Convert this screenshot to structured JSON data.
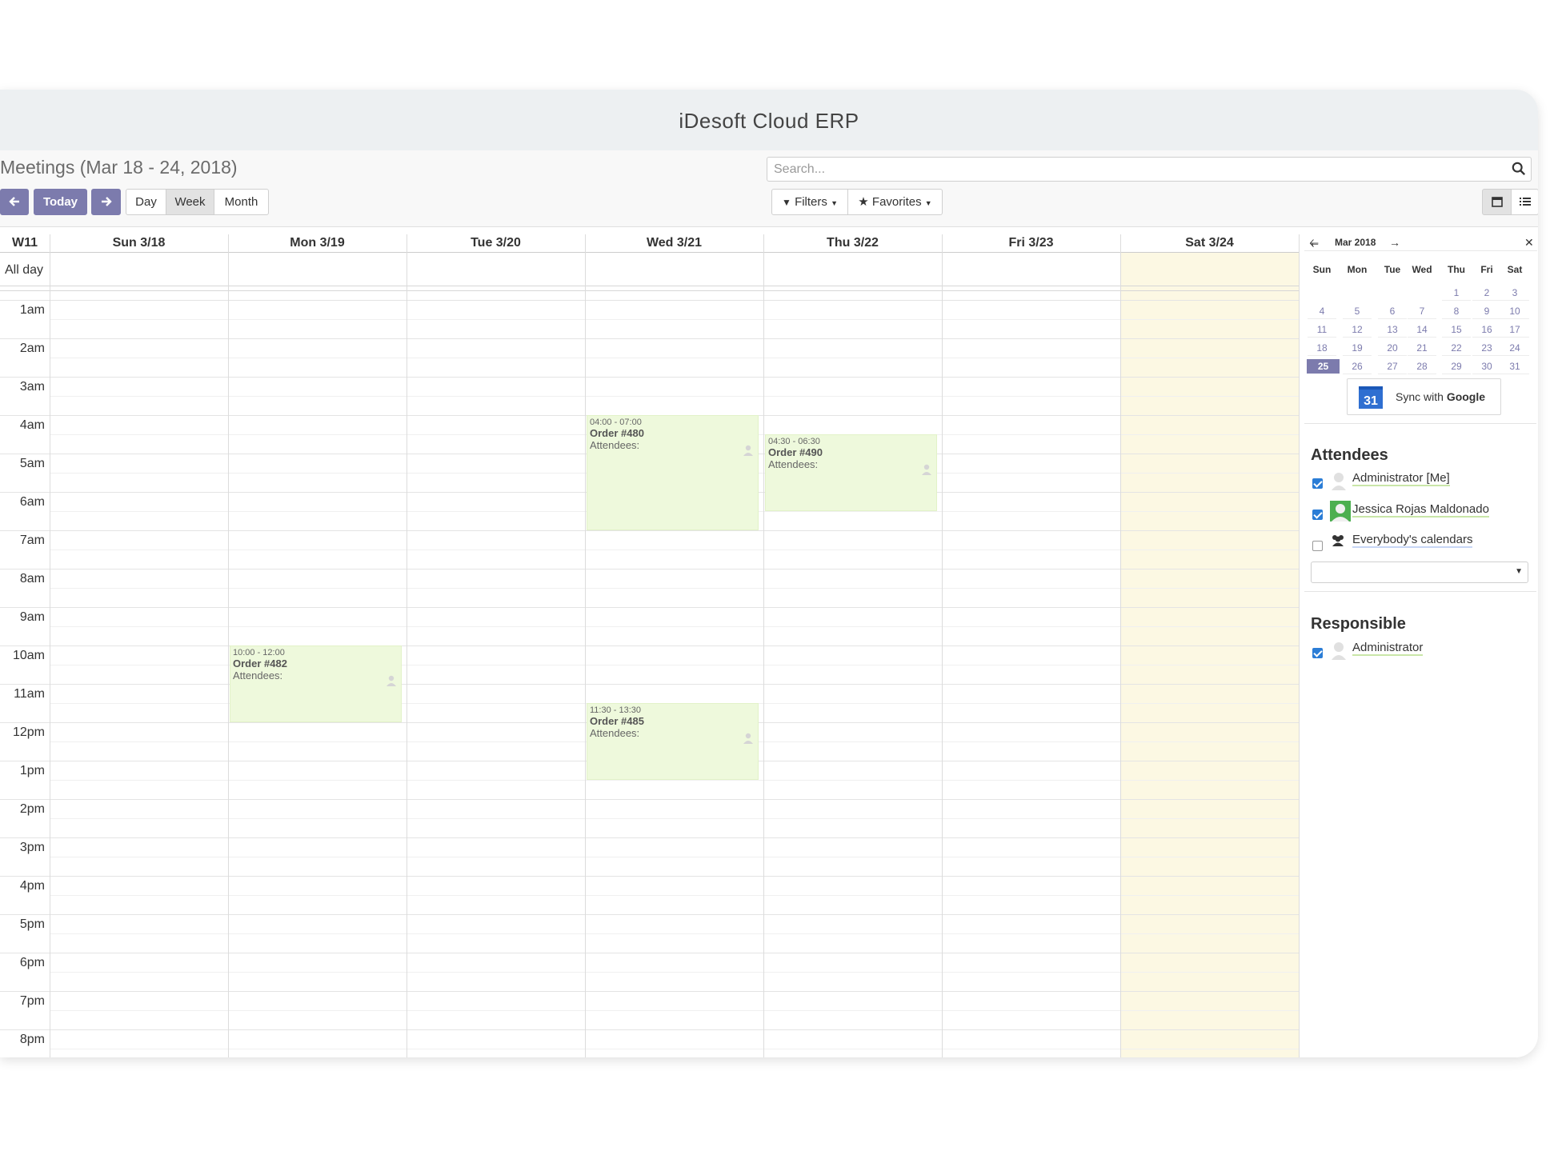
{
  "window": {
    "title": "iDesoft Cloud ERP"
  },
  "breadcrumb": "Meetings (Mar 18 - 24, 2018)",
  "search": {
    "placeholder": "Search..."
  },
  "nav": {
    "today": "Today",
    "day": "Day",
    "week": "Week",
    "month": "Month"
  },
  "filters": {
    "filters_label": "Filters",
    "favorites_label": "Favorites"
  },
  "views": {
    "active": "calendar"
  },
  "calendar": {
    "week_label": "W11",
    "all_day_label": "All day",
    "days": [
      "Sun 3/18",
      "Mon 3/19",
      "Tue 3/20",
      "Wed 3/21",
      "Thu 3/22",
      "Fri 3/23",
      "Sat 3/24"
    ],
    "today_index": 6,
    "hours": [
      "1am",
      "2am",
      "3am",
      "4am",
      "5am",
      "6am",
      "7am",
      "8am",
      "9am",
      "10am",
      "11am",
      "12pm",
      "1pm",
      "2pm",
      "3pm",
      "4pm",
      "5pm",
      "6pm",
      "7pm",
      "8pm"
    ],
    "events": [
      {
        "day": 3,
        "start": 4,
        "end": 7,
        "time": "04:00 - 07:00",
        "title": "Order #480",
        "attendees": "Attendees:"
      },
      {
        "day": 4,
        "start": 4.5,
        "end": 6.5,
        "time": "04:30 - 06:30",
        "title": "Order #490",
        "attendees": "Attendees:"
      },
      {
        "day": 1,
        "start": 10,
        "end": 12,
        "time": "10:00 - 12:00",
        "title": "Order #482",
        "attendees": "Attendees:"
      },
      {
        "day": 3,
        "start": 11.5,
        "end": 13.5,
        "time": "11:30 - 13:30",
        "title": "Order #485",
        "attendees": "Attendees:"
      }
    ]
  },
  "mini_calendar": {
    "title": "Mar 2018",
    "day_headers": [
      "Sun",
      "Mon",
      "Tue",
      "Wed",
      "Thu",
      "Fri",
      "Sat"
    ],
    "weeks": [
      [
        "",
        "",
        "",
        "",
        "1",
        "2",
        "3"
      ],
      [
        "4",
        "5",
        "6",
        "7",
        "8",
        "9",
        "10"
      ],
      [
        "11",
        "12",
        "13",
        "14",
        "15",
        "16",
        "17"
      ],
      [
        "18",
        "19",
        "20",
        "21",
        "22",
        "23",
        "24"
      ],
      [
        "25",
        "26",
        "27",
        "28",
        "29",
        "30",
        "31"
      ]
    ],
    "selected": "25"
  },
  "sync": {
    "label_plain": "Sync with ",
    "label_bold": "Google",
    "icon_text": "31"
  },
  "attendees": {
    "title": "Attendees",
    "items": [
      {
        "name": "Administrator [Me]",
        "checked": true
      },
      {
        "name": "Jessica Rojas Maldonado",
        "checked": true
      },
      {
        "name": "Everybody's calendars",
        "checked": false
      }
    ]
  },
  "responsible": {
    "title": "Responsible",
    "items": [
      {
        "name": "Administrator",
        "checked": true
      }
    ]
  },
  "colors": {
    "accent": "#7c7bad",
    "event_bg": "#eef9dc",
    "today_bg": "#fcf8e3"
  }
}
